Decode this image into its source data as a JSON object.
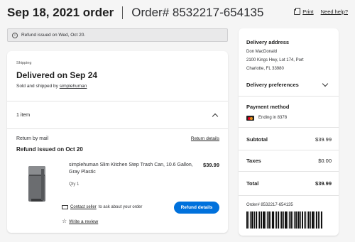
{
  "header": {
    "date_title": "Sep 18, 2021 order",
    "order_number": "Order# 8532217-654135",
    "print_label": "Print",
    "help_label": "Need help?"
  },
  "notice": {
    "text": "Refund issued on Wed, Oct 20."
  },
  "shipment": {
    "label": "Shipping",
    "status": "Delivered on Sep 24",
    "sold_by_prefix": "Sold and shipped by",
    "seller": "simplehuman",
    "items_count": "1 item",
    "return_method": "Return by mail",
    "return_details_label": "Return details",
    "refund_status": "Refund issued on Oct 20",
    "product": {
      "name": "simplehuman Slim Kitchen Step Trash Can, 10.6 Gallon, Gray Plastic",
      "price": "$39.99",
      "qty": "Qty 1"
    },
    "contact_seller_label": "Contact seller",
    "contact_seller_suffix": "to ask about your order",
    "review_label": "Write a review",
    "refund_button": "Refund details"
  },
  "sidebar": {
    "delivery_address_title": "Delivery address",
    "address_name": "Don MacDonald",
    "address_line1": "2100 Kings Hwy, Lot 174, Port",
    "address_line2": "Charlotte, FL 33980",
    "delivery_prefs_title": "Delivery preferences",
    "payment_title": "Payment method",
    "card_ending": "Ending in 8378",
    "subtotal_label": "Subtotal",
    "subtotal_value": "$39.99",
    "taxes_label": "Taxes",
    "taxes_value": "$0.00",
    "total_label": "Total",
    "total_value": "$39.99",
    "order_ref": "Order# 8532217-654135"
  },
  "icons": [
    "print-icon",
    "info-icon",
    "chevron-up-icon",
    "chevron-down-icon",
    "mail-icon",
    "star-icon",
    "mastercard-icon",
    "barcode"
  ],
  "colors": {
    "accent": "#0071dc",
    "background": "#f5f5f5"
  }
}
